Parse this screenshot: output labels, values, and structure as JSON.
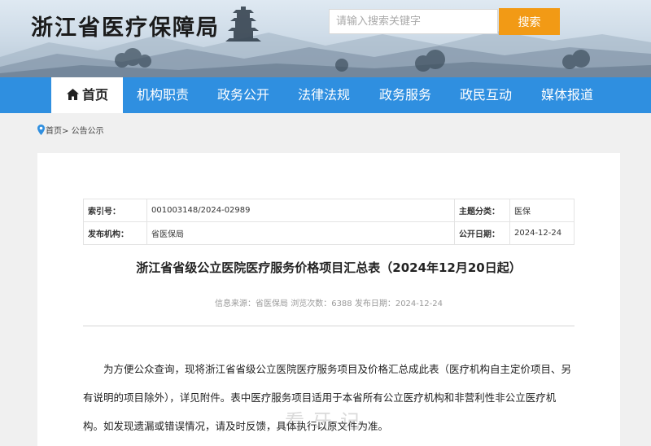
{
  "header": {
    "site_title": "浙江省医疗保障局",
    "search_placeholder": "请输入搜索关键字",
    "search_button": "搜索"
  },
  "nav": {
    "items": [
      {
        "label": "首页",
        "active": true
      },
      {
        "label": "机构职责"
      },
      {
        "label": "政务公开"
      },
      {
        "label": "法律法规"
      },
      {
        "label": "政务服务"
      },
      {
        "label": "政民互动"
      },
      {
        "label": "媒体报道"
      }
    ]
  },
  "breadcrumb": {
    "home": "首页",
    "separator": ">",
    "current": "公告公示"
  },
  "meta": {
    "index_label": "索引号：",
    "index_value": "001003148/2024-02989",
    "category_label": "主题分类：",
    "category_value": "医保",
    "org_label": "发布机构：",
    "org_value": "省医保局",
    "date_label": "公开日期：",
    "date_value": "2024-12-24"
  },
  "article": {
    "title": "浙江省省级公立医院医疗服务价格项目汇总表（2024年12月20日起）",
    "info": "信息来源：省医保局 浏览次数：6388 发布日期：2024-12-24",
    "body": "为方便公众查询，现将浙江省省级公立医院医疗服务项目及价格汇总成此表（医疗机构自主定价项目、另有说明的项目除外），详见附件。表中医疗服务项目适用于本省所有公立医疗机构和非营利性非公立医疗机构。如发现遗漏或错误情况，请及时反馈，具体执行以原文件为准。"
  },
  "watermark": "看牙记",
  "colors": {
    "nav_blue": "#2f8fe0",
    "search_orange": "#f29a15",
    "page_bg": "#f0f0f0"
  }
}
